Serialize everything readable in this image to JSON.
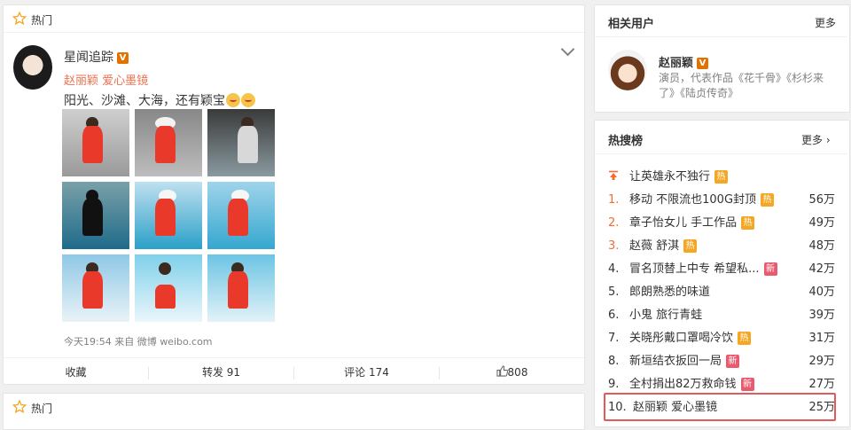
{
  "feed": {
    "section_label": "热门",
    "post": {
      "username": "星闻追踪",
      "verified_mark": "V",
      "topic_tag": "赵丽颖 爱心墨镜",
      "text": "阳光、沙滩、大海，还有颖宝",
      "meta": "今天19:54 来自 微博 weibo.com",
      "actions": {
        "favorite": "收藏",
        "repost": "转发 91",
        "comment": "评论 174",
        "like": "808"
      }
    },
    "second_section_label": "热门"
  },
  "sidebar": {
    "related_users": {
      "title": "相关用户",
      "more": "更多",
      "user": {
        "name": "赵丽颖",
        "verified_mark": "V",
        "desc": "演员，代表作品《花千骨》《杉杉来了》《陆贞传奇》"
      }
    },
    "hot_search": {
      "title": "热搜榜",
      "more": "更多 ›",
      "pinned": {
        "text": "让英雄永不独行",
        "badge": "热"
      },
      "items": [
        {
          "rank": "1.",
          "text": "移动 不限流也100G封顶",
          "badge": "热",
          "badge_type": "hot",
          "count": "56万"
        },
        {
          "rank": "2.",
          "text": "章子怡女儿 手工作品",
          "badge": "热",
          "badge_type": "hot",
          "count": "49万"
        },
        {
          "rank": "3.",
          "text": "赵薇 舒淇",
          "badge": "热",
          "badge_type": "hot",
          "count": "48万"
        },
        {
          "rank": "4.",
          "text": "冒名顶替上中专 希望私...",
          "badge": "新",
          "badge_type": "new",
          "count": "42万"
        },
        {
          "rank": "5.",
          "text": "郎朗熟悉的味道",
          "badge": "",
          "badge_type": "",
          "count": "40万"
        },
        {
          "rank": "6.",
          "text": "小鬼 旅行青蛙",
          "badge": "",
          "badge_type": "",
          "count": "39万"
        },
        {
          "rank": "7.",
          "text": "关晓彤戴口罩喝冷饮",
          "badge": "热",
          "badge_type": "hot",
          "count": "31万"
        },
        {
          "rank": "8.",
          "text": "新垣结衣扳回一局",
          "badge": "新",
          "badge_type": "new",
          "count": "29万"
        },
        {
          "rank": "9.",
          "text": "全村捐出82万救命钱",
          "badge": "新",
          "badge_type": "new",
          "count": "27万"
        },
        {
          "rank": "10.",
          "text": "赵丽颖 爱心墨镜",
          "badge": "",
          "badge_type": "",
          "count": "25万"
        }
      ]
    }
  },
  "colors": {
    "accent_orange": "#eb7350",
    "hot_badge": "#f5a623",
    "new_badge": "#ea5a6f",
    "highlight_box": "#e35a5a"
  },
  "icons": [
    "star-icon",
    "chevron-down-icon",
    "thumbs-up-icon",
    "up-arrow-icon",
    "verified-icon"
  ]
}
